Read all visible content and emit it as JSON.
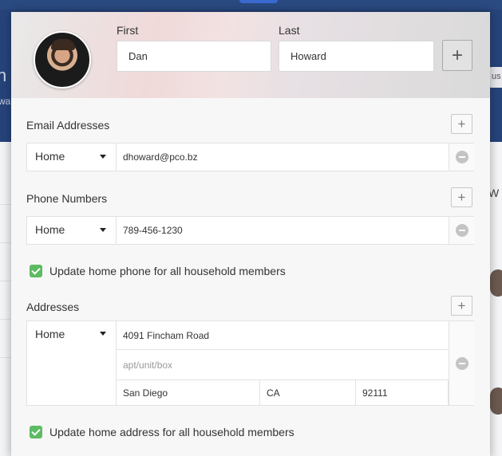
{
  "name": {
    "first_label": "First",
    "first_value": "Dan",
    "last_label": "Last",
    "last_value": "Howard"
  },
  "email_section": {
    "title": "Email Addresses",
    "rows": [
      {
        "type": "Home",
        "value": "dhoward@pco.bz"
      }
    ]
  },
  "phone_section": {
    "title": "Phone Numbers",
    "rows": [
      {
        "type": "Home",
        "value": "789-456-1230"
      }
    ],
    "update_checkbox_label": "Update home phone for all household members"
  },
  "address_section": {
    "title": "Addresses",
    "type": "Home",
    "street": "4091  Fincham Road",
    "apt_placeholder": "apt/unit/box",
    "city": "San Diego",
    "state": "CA",
    "zip": "92111",
    "update_checkbox_label": "Update home address for all household members"
  },
  "icons": {
    "add": "plus-icon",
    "remove": "minus-circle-icon",
    "dropdown": "caret-down-icon"
  },
  "colors": {
    "check_green": "#5dbb63",
    "header_bg": "#26447a"
  }
}
